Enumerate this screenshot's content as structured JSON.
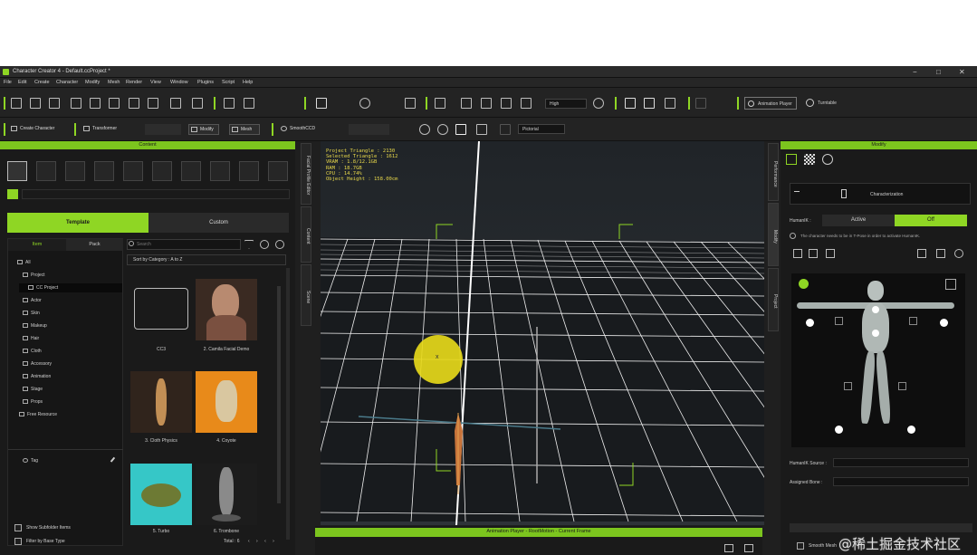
{
  "window": {
    "title": "Character Creator 4 - Default.ccProject *",
    "controls": [
      "−",
      "□",
      "✕"
    ]
  },
  "menu": [
    "File",
    "Edit",
    "Create",
    "Character",
    "Modify",
    "Mesh",
    "Render",
    "View",
    "Window",
    "Plugins",
    "Script",
    "Help"
  ],
  "toolbar": {
    "quality": "High",
    "animation_player_label": "Animation Player",
    "turntable_label": "Turntable",
    "create_character_label": "Create Character",
    "transformer_label": "Transformer",
    "modify_label": "Modify",
    "mesh_label": "Mesh",
    "smooth_label": "SmoothCCD",
    "view_mode": "Pictorial"
  },
  "content_panel": {
    "title": "Content",
    "tab_template": "Template",
    "tab_custom": "Custom",
    "subtab_item": "Item",
    "subtab_pack": "Pack",
    "search_placeholder": "Search",
    "sort_label": "Sort by Category : A to Z",
    "tree": [
      "All",
      "Project",
      "CC Project",
      "Actor",
      "Skin",
      "Makeup",
      "Hair",
      "Cloth",
      "Accessory",
      "Animation",
      "Stage",
      "Props",
      "Free Resource"
    ],
    "tag_label": "Tag",
    "thumbs": [
      {
        "label": "CC3",
        "color": "#2a2a2a"
      },
      {
        "label": "2. Camila Facial Demo",
        "color": "#3a2a22"
      },
      {
        "label": "3. Cloth Physics",
        "color": "#30241c"
      },
      {
        "label": "4. Coyote",
        "color": "#e88a1a"
      },
      {
        "label": "5. Turbo",
        "color": "#36c7c7"
      },
      {
        "label": "6. Trombone",
        "color": "#1c1c1c"
      }
    ],
    "show_subfolder_items": "Show Subfolder Items",
    "filter_by_base_type": "Filter by Base Type",
    "total_label": "Total : 6"
  },
  "side_tabs_left": [
    "Facial Profile Editor",
    "Content",
    "Scene"
  ],
  "side_tabs_right": [
    "Performance",
    "Modify",
    "Project"
  ],
  "viewport": {
    "stats": [
      "Project Triangle : 2130",
      "Selected Triangle : 1612",
      "VRAM : 1.8/12.1GB",
      "RAM : 18.7GB",
      "CPU : 14.74%",
      "Object Height : 158.00cm"
    ],
    "cursor_marker": "x"
  },
  "animation_bar": {
    "title": "Animation Player - RootMotion - Current Frame"
  },
  "modify_panel": {
    "title": "Modify",
    "characterization_label": "Characterization",
    "humanik_label": "HumanIK :",
    "humanik_active": "Active",
    "humanik_off": "Off",
    "tpose_note": "The character needs to be in T-Pose in order to activate HumanIK.",
    "humanik_source_label": "HumanIK Source :",
    "assigned_bone_label": "Assigned Bone :",
    "smooth_mesh_label": "Smooth Mesh"
  },
  "colors": {
    "accent": "#8fd624",
    "panel": "#1a1a1a",
    "bg": "#1f1f1f"
  },
  "watermark": "@稀土掘金技术社区"
}
